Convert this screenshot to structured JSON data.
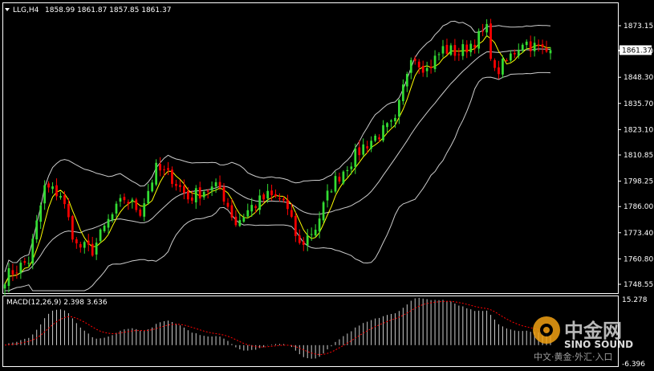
{
  "header": {
    "symbol": "LLG,H4",
    "ohlc": "1858.99 1861.87 1857.85 1861.37"
  },
  "macd": {
    "label": "MACD(12,26,9) 2.398 3.636",
    "scale_top": "15.278",
    "scale_bottom": "-6.396"
  },
  "current_price_label": "1861.37",
  "watermark": {
    "brand_cn": "中金网",
    "brand_en": "SINO SOUND",
    "slogan": "中文·黄金·外汇·入口"
  },
  "colors": {
    "background": "#000000",
    "grid_frame": "#ffffff",
    "bull": "#33dd33",
    "bear": "#ff0000",
    "bands": "#cccccc",
    "ma": "#ffff00",
    "macd_hist": "#cccccc",
    "macd_signal": "#ff0000"
  },
  "chart_data": [
    {
      "type": "candlestick",
      "title": "LLG,H4",
      "ylim": [
        1745,
        1880
      ],
      "yticks": [
        "1873.15",
        "1861.00",
        "1848.30",
        "1835.70",
        "1823.10",
        "1810.85",
        "1798.25",
        "1786.00",
        "1773.40",
        "1760.80",
        "1748.55"
      ],
      "overlays": [
        "bollinger-upper",
        "bollinger-middle",
        "bollinger-lower",
        "moving-average"
      ],
      "anchors": [
        [
          0,
          1752
        ],
        [
          6,
          1760
        ],
        [
          10,
          1795
        ],
        [
          14,
          1792
        ],
        [
          18,
          1767
        ],
        [
          22,
          1765
        ],
        [
          26,
          1779
        ],
        [
          30,
          1790
        ],
        [
          34,
          1784
        ],
        [
          38,
          1804
        ],
        [
          42,
          1800
        ],
        [
          46,
          1790
        ],
        [
          50,
          1794
        ],
        [
          54,
          1795
        ],
        [
          58,
          1778
        ],
        [
          62,
          1786
        ],
        [
          66,
          1791
        ],
        [
          70,
          1789
        ],
        [
          74,
          1767
        ],
        [
          78,
          1776
        ],
        [
          82,
          1796
        ],
        [
          86,
          1806
        ],
        [
          90,
          1815
        ],
        [
          94,
          1821
        ],
        [
          98,
          1826
        ],
        [
          102,
          1860
        ],
        [
          106,
          1852
        ],
        [
          110,
          1862
        ],
        [
          114,
          1860
        ],
        [
          118,
          1866
        ],
        [
          121,
          1871
        ],
        [
          123,
          1850
        ],
        [
          126,
          1856
        ],
        [
          130,
          1866
        ],
        [
          134,
          1862
        ],
        [
          137,
          1860
        ]
      ],
      "last_price": 1861.37
    },
    {
      "type": "bar",
      "title": "MACD(12,26,9)",
      "ylim": [
        -6.396,
        15.278
      ],
      "macd": 2.398,
      "signal": 3.636
    }
  ]
}
